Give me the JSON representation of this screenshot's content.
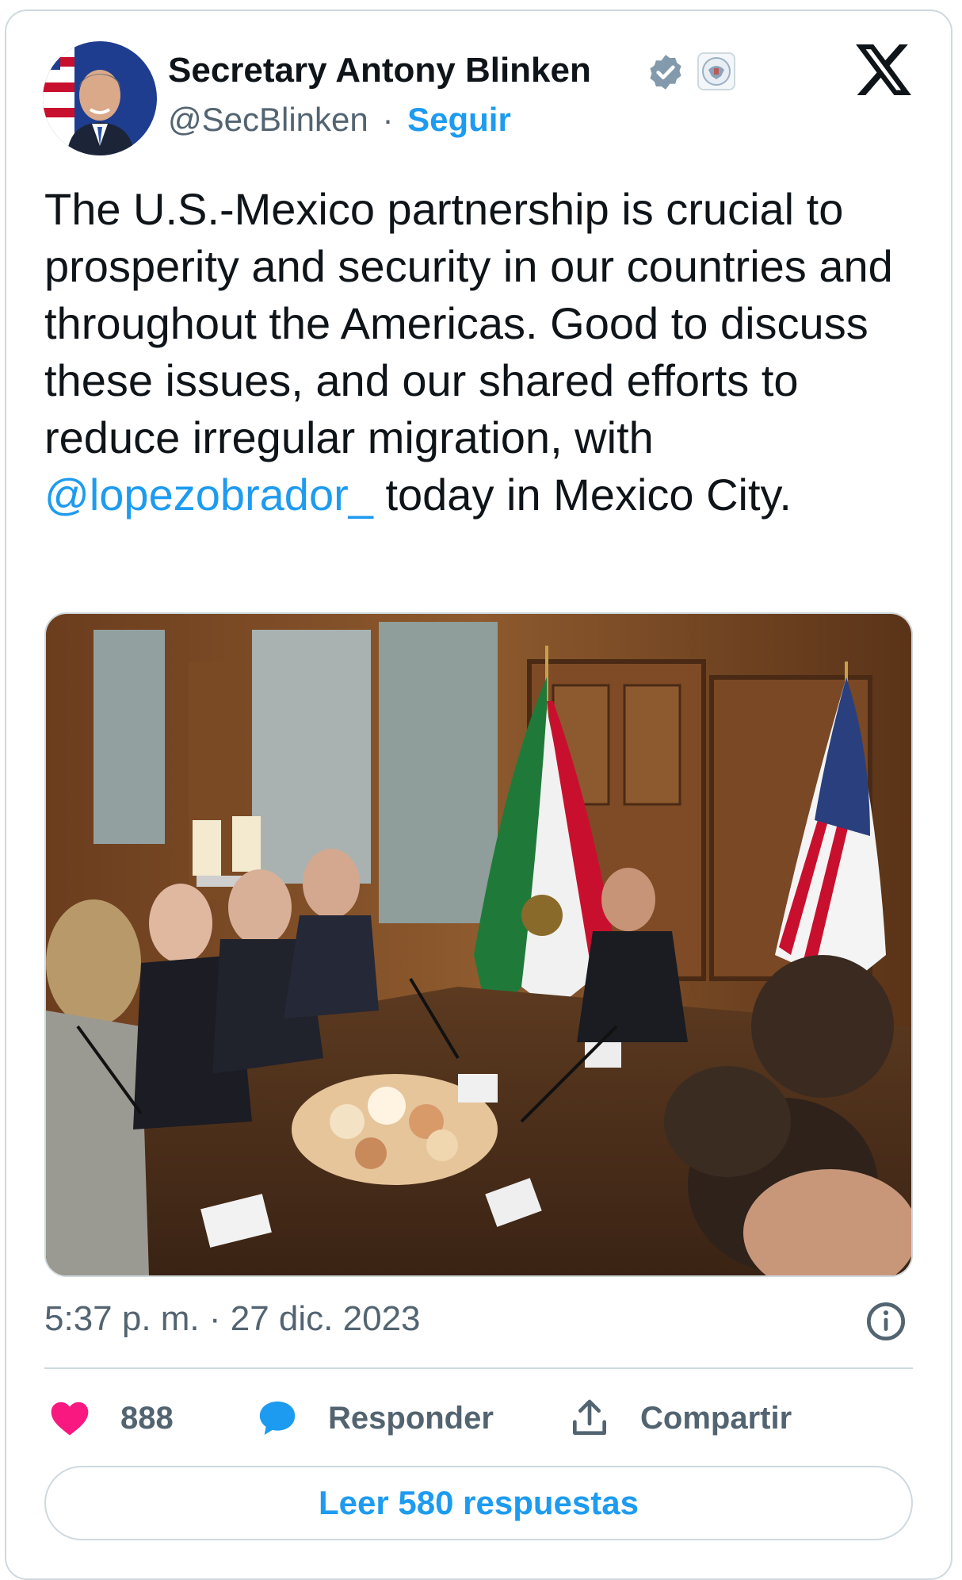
{
  "author": {
    "name": "Secretary Antony Blinken",
    "handle": "@SecBlinken",
    "separator": "·",
    "follow_label": "Seguir"
  },
  "tweet": {
    "text_before_mention": "The U.S.-Mexico partnership is crucial to prosperity and security in our countries and throughout the Americas. Good to discuss these issues, and our shared efforts to reduce irregular migration, with ",
    "mention": "@lopezobrador_",
    "text_after_mention": " today in Mexico City."
  },
  "meta": {
    "timestamp": "5:37 p. m. · 27 dic. 2023"
  },
  "actions": {
    "like_count": "888",
    "reply_label": "Responder",
    "share_label": "Compartir"
  },
  "read_replies_label": "Leer 580 respuestas",
  "icons": {
    "verified": "verified-badge-icon",
    "affiliation": "state-department-seal-icon",
    "platform": "x-logo-icon",
    "info": "info-icon",
    "like": "heart-icon",
    "reply": "speech-bubble-icon",
    "share": "share-upload-icon"
  },
  "colors": {
    "accent": "#1d9bf0",
    "like": "#f91880",
    "text": "#0f1419",
    "secondary": "#536471",
    "border": "#cfd9de"
  }
}
